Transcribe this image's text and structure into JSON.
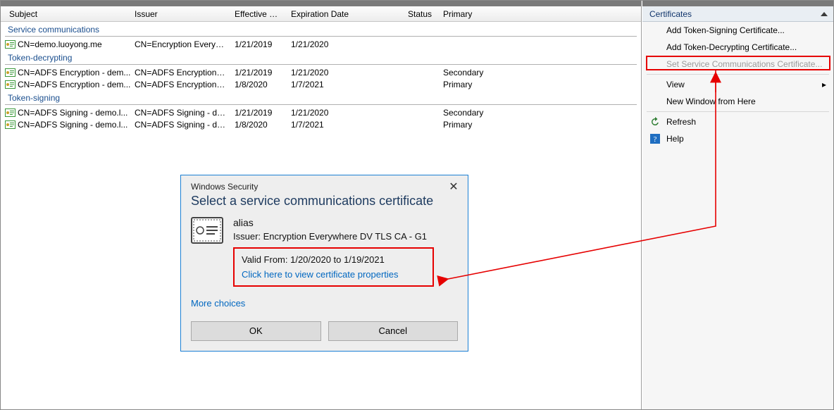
{
  "columns": {
    "subject": "Subject",
    "issuer": "Issuer",
    "effective": "Effective Date",
    "expiration": "Expiration Date",
    "status": "Status",
    "primary": "Primary"
  },
  "groups": [
    {
      "label": "Service communications",
      "rows": [
        {
          "subject": "CN=demo.luoyong.me",
          "issuer": "CN=Encryption Everywher...",
          "eff": "1/21/2019",
          "exp": "1/21/2020",
          "status": "",
          "primary": ""
        }
      ]
    },
    {
      "label": "Token-decrypting",
      "rows": [
        {
          "subject": "CN=ADFS Encryption - dem...",
          "issuer": "CN=ADFS Encryption - de...",
          "eff": "1/21/2019",
          "exp": "1/21/2020",
          "status": "",
          "primary": "Secondary"
        },
        {
          "subject": "CN=ADFS Encryption - dem...",
          "issuer": "CN=ADFS Encryption - de...",
          "eff": "1/8/2020",
          "exp": "1/7/2021",
          "status": "",
          "primary": "Primary"
        }
      ]
    },
    {
      "label": "Token-signing",
      "rows": [
        {
          "subject": "CN=ADFS Signing - demo.l...",
          "issuer": "CN=ADFS Signing - demo....",
          "eff": "1/21/2019",
          "exp": "1/21/2020",
          "status": "",
          "primary": "Secondary"
        },
        {
          "subject": "CN=ADFS Signing - demo.l...",
          "issuer": "CN=ADFS Signing - demo....",
          "eff": "1/8/2020",
          "exp": "1/7/2021",
          "status": "",
          "primary": "Primary"
        }
      ]
    }
  ],
  "actions": {
    "title": "Certificates",
    "items": {
      "add_signing": "Add Token-Signing Certificate...",
      "add_decrypting": "Add Token-Decrypting Certificate...",
      "set_service": "Set Service Communications Certificate...",
      "view": "View",
      "new_window": "New Window from Here",
      "refresh": "Refresh",
      "help": "Help"
    }
  },
  "dialog": {
    "caption": "Windows Security",
    "title": "Select a service communications certificate",
    "alias": "alias",
    "issuer": "Issuer: Encryption Everywhere DV TLS CA - G1",
    "valid": "Valid From: 1/20/2020 to 1/19/2021",
    "view_props": "Click here to view certificate properties",
    "more": "More choices",
    "ok": "OK",
    "cancel": "Cancel"
  }
}
